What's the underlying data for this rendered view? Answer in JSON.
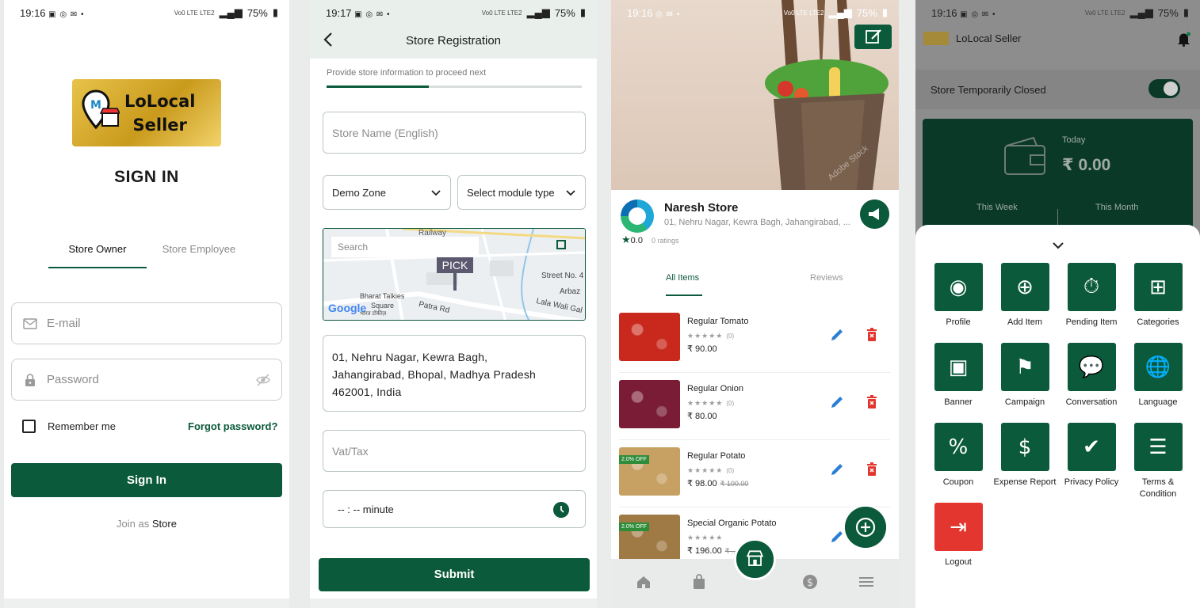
{
  "status_bars": [
    {
      "time": "19:16",
      "battery": "75%",
      "network": "Vo0 LTE LTE2"
    },
    {
      "time": "19:17",
      "battery": "75%",
      "network": "Vo0 LTE LTE2"
    },
    {
      "time": "19:16",
      "battery": "75%",
      "network": "Vo0 LTE LTE2"
    },
    {
      "time": "19:16",
      "battery": "75%",
      "network": "Vo0 LTE LTE2"
    }
  ],
  "signin": {
    "logo_line1": "LoLocal",
    "logo_line2": "Seller",
    "title": "SIGN IN",
    "tab_owner": "Store Owner",
    "tab_employee": "Store Employee",
    "email_placeholder": "E-mail",
    "password_placeholder": "Password",
    "remember": "Remember me",
    "forgot": "Forgot password?",
    "button": "Sign In",
    "join_prefix": "Join as",
    "join_link": "Store"
  },
  "registration": {
    "title": "Store Registration",
    "subtitle": "Provide store information to proceed next",
    "progress": 0.4,
    "store_name_placeholder": "Store Name (English)",
    "zone": "Demo Zone",
    "module": "Select module type",
    "map": {
      "search": "Search",
      "pick": "PICK",
      "labels": [
        "Railway",
        "Street No. 4",
        "Arbaz",
        "Bharat Talkies",
        "Square",
        "भारत टॉकीज़",
        "Patra Rd",
        "Lala Wali Gal"
      ],
      "brand": "Google"
    },
    "address_lines": [
      "01, Nehru Nagar, Kewra Bagh,",
      "Jahangirabad, Bhopal, Madhya Pradesh",
      "462001, India"
    ],
    "vat_placeholder": "Vat/Tax",
    "time_placeholder": "-- : -- minute",
    "submit": "Submit"
  },
  "store": {
    "name": "Naresh Store",
    "address": "01, Nehru Nagar, Kewra Bagh, Jahangirabad, ...",
    "rating": "0.0",
    "ratings_count": "0 ratings",
    "tab_items": "All Items",
    "tab_reviews": "Reviews",
    "hero_watermark": "Adobe Stock",
    "items": [
      {
        "name": "Regular Tomato",
        "reviews": "(0)",
        "price": "₹ 90.00",
        "old_price": "",
        "discount": "",
        "color": "#c9291d"
      },
      {
        "name": "Regular Onion",
        "reviews": "(0)",
        "price": "₹ 80.00",
        "old_price": "",
        "discount": "",
        "color": "#7a1c36"
      },
      {
        "name": "Regular Potato",
        "reviews": "(0)",
        "price": "₹ 98.00",
        "old_price": "₹ 100.00",
        "discount": "2.0% OFF",
        "color": "#c7a064"
      },
      {
        "name": "Special Organic Potato",
        "reviews": "",
        "price": "₹ 196.00",
        "old_price": "₹ ...",
        "discount": "2.0% OFF",
        "color": "#a07a44"
      }
    ]
  },
  "dashboard": {
    "app_name": "LoLocal Seller",
    "store_closed": "Store Temporarily Closed",
    "store_closed_on": true,
    "today_label": "Today",
    "today_amount": "₹ 0.00",
    "week": "This Week",
    "month": "This Month",
    "menu": [
      {
        "label": "Profile",
        "icon": "profile-icon"
      },
      {
        "label": "Add Item",
        "icon": "add-item-icon"
      },
      {
        "label": "Pending Item",
        "icon": "pending-item-icon"
      },
      {
        "label": "Categories",
        "icon": "categories-icon"
      },
      {
        "label": "Banner",
        "icon": "banner-icon"
      },
      {
        "label": "Campaign",
        "icon": "campaign-icon"
      },
      {
        "label": "Conversation",
        "icon": "conversation-icon"
      },
      {
        "label": "Language",
        "icon": "language-icon"
      },
      {
        "label": "Coupon",
        "icon": "coupon-icon"
      },
      {
        "label": "Expense Report",
        "icon": "expense-report-icon"
      },
      {
        "label": "Privacy Policy",
        "icon": "privacy-policy-icon"
      },
      {
        "label": "Terms & Condition",
        "icon": "terms-condition-icon"
      },
      {
        "label": "Logout",
        "icon": "logout-icon"
      }
    ]
  },
  "colors": {
    "primary": "#0b5a3b",
    "danger": "#e2362f",
    "edit": "#2a7fd4"
  }
}
